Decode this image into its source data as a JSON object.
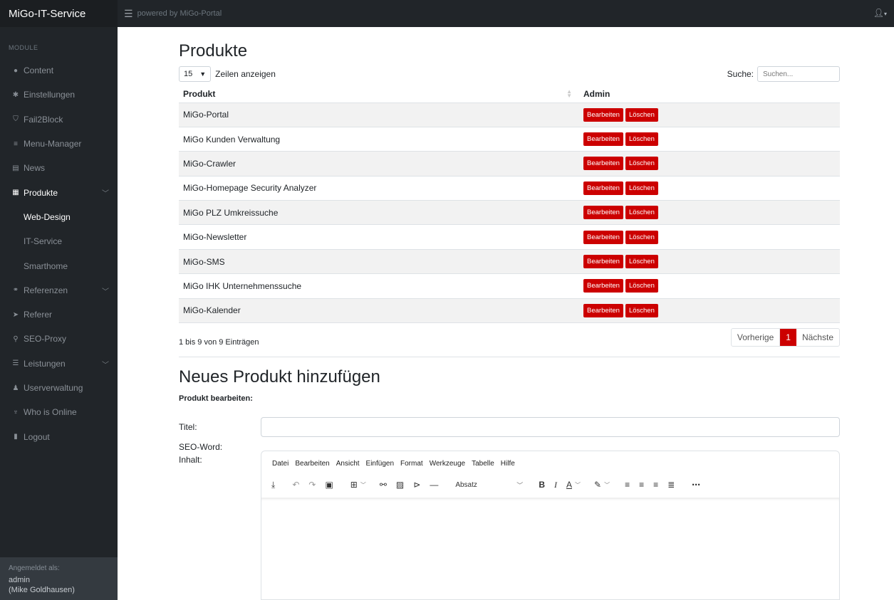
{
  "app": {
    "brand": "MiGo-IT-Service",
    "powered_by": "powered by MiGo-Portal",
    "user_icon": "user-icon"
  },
  "sidebar": {
    "heading": "MODULE",
    "items": [
      {
        "label": "Content",
        "icon": "gear-circle-icon"
      },
      {
        "label": "Einstellungen",
        "icon": "cog-icon"
      },
      {
        "label": "Fail2Block",
        "icon": "shield-icon"
      },
      {
        "label": "Menu-Manager",
        "icon": "list-icon"
      },
      {
        "label": "News",
        "icon": "newspaper-icon"
      },
      {
        "label": "Produkte",
        "icon": "box-icon"
      },
      {
        "label": "Referenzen",
        "icon": "handshake-icon"
      },
      {
        "label": "Referer",
        "icon": "send-icon"
      },
      {
        "label": "SEO-Proxy",
        "icon": "search-icon"
      },
      {
        "label": "Leistungen",
        "icon": "server-icon"
      },
      {
        "label": "Userverwaltung",
        "icon": "user-icon"
      },
      {
        "label": "Who is Online",
        "icon": "plug-icon"
      },
      {
        "label": "Logout",
        "icon": "logout-icon"
      }
    ],
    "subitems": [
      "Web-Design",
      "IT-Service",
      "Smarthome"
    ],
    "footer_label": "Angemeldet als:",
    "footer_user": "admin",
    "footer_name": "(Mike Goldhausen)"
  },
  "products": {
    "title": "Produkte",
    "length_value": "15",
    "length_label": "Zeilen anzeigen",
    "search_label": "Suche:",
    "search_placeholder": "Suchen...",
    "col_product": "Produkt",
    "col_admin": "Admin",
    "edit_label": "Bearbeiten",
    "delete_label": "Löschen",
    "rows": [
      "MiGo-Portal",
      "MiGo Kunden Verwaltung",
      "MiGo-Crawler",
      "MiGo-Homepage Security Analyzer",
      "MiGo PLZ Umkreissuche",
      "MiGo-Newsletter",
      "MiGo-SMS",
      "MiGo IHK Unternehmenssuche",
      "MiGo-Kalender"
    ],
    "info": "1 bis 9 von 9 Einträgen",
    "prev": "Vorherige",
    "page": "1",
    "next": "Nächste"
  },
  "new_product": {
    "title": "Neues Produkt hinzufügen",
    "subtitle": "Produkt bearbeiten:",
    "title_label": "Titel:",
    "seo_label": "SEO-Word:",
    "content_label": "Inhalt:",
    "title_value": ""
  },
  "editor": {
    "menu": [
      "Datei",
      "Bearbeiten",
      "Ansicht",
      "Einfügen",
      "Format",
      "Werkzeuge",
      "Tabelle",
      "Hilfe"
    ],
    "format_value": "Absatz"
  },
  "colors": {
    "accent": "#cc0000",
    "sidebar": "#212529"
  }
}
